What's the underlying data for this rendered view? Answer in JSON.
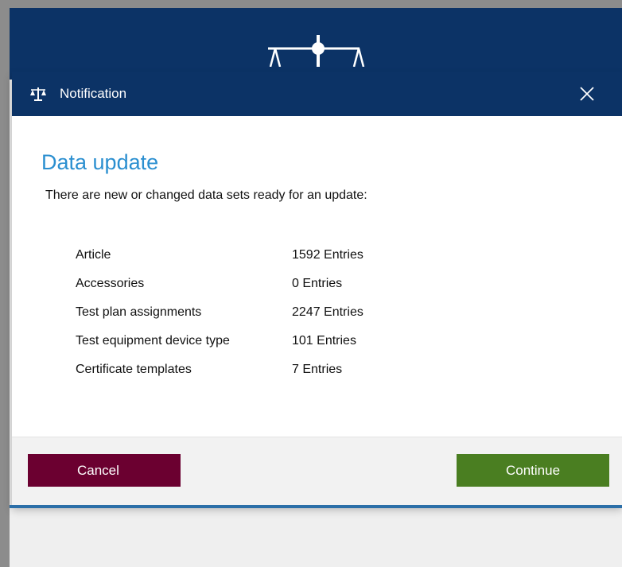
{
  "dialog": {
    "title": "Notification",
    "heading": "Data update",
    "intro": "There are new or changed data sets ready for an update:",
    "entries": [
      {
        "name": "Article",
        "count": "1592 Entries"
      },
      {
        "name": "Accessories",
        "count": "0 Entries"
      },
      {
        "name": "Test plan assignments",
        "count": "2247 Entries"
      },
      {
        "name": "Test equipment device type",
        "count": "101 Entries"
      },
      {
        "name": "Certificate templates",
        "count": "7 Entries"
      }
    ],
    "buttons": {
      "cancel": "Cancel",
      "continue": "Continue"
    }
  },
  "icons": {
    "app_logo": "scale-icon",
    "title": "scale-icon",
    "close": "close-icon"
  },
  "colors": {
    "header": "#0c3366",
    "heading": "#2b8fd0",
    "cancel": "#6b0030",
    "continue": "#4a7e21"
  }
}
